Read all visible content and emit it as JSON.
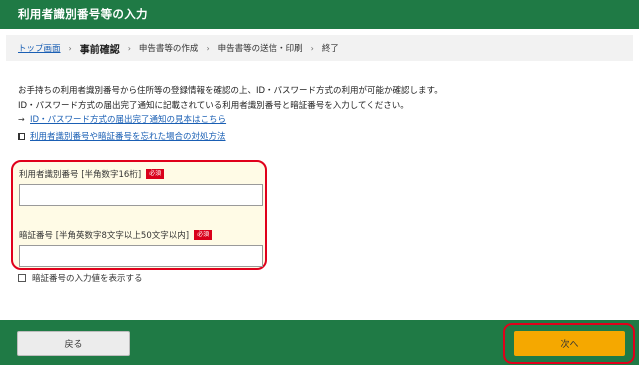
{
  "header": {
    "title": "利用者識別番号等の入力"
  },
  "breadcrumb": {
    "top_link": "トップ画面",
    "current": "事前確認",
    "steps": [
      "申告書等の作成",
      "申告書等の送信・印刷",
      "終了"
    ]
  },
  "intro": {
    "line1": "お手持ちの利用者識別番号から住所等の登録情報を確認の上、ID・パスワード方式の利用が可能か確認します。",
    "line2": "ID・パスワード方式の届出完了通知に記載されている利用者識別番号と暗証番号を入力してください。"
  },
  "links": {
    "sample": "ID・パスワード方式の届出完了通知の見本はこちら",
    "forgot": "利用者識別番号や暗証番号を忘れた場合の対処方法"
  },
  "form": {
    "user_id_label": "利用者識別番号 [半角数字16桁]",
    "user_id_required": "必須",
    "user_id_value": "",
    "password_label": "暗証番号 [半角英数字8文字以上50文字以内]",
    "password_required": "必須",
    "password_value": ""
  },
  "show_password_label": "暗証番号の入力値を表示する",
  "footer": {
    "back_label": "戻る",
    "next_label": "次へ"
  }
}
